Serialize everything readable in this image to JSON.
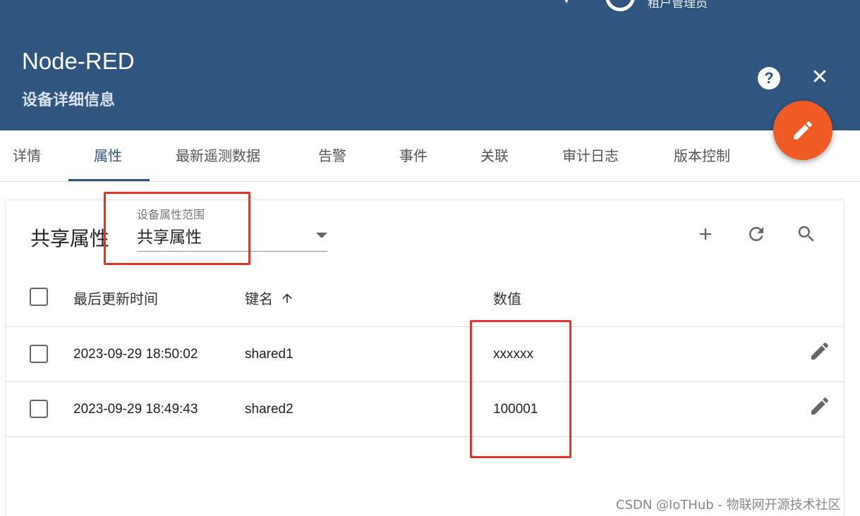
{
  "header": {
    "user_role": "租户管理员",
    "title": "Node-RED",
    "subtitle": "设备详细信息"
  },
  "tabs": [
    {
      "label": "详情"
    },
    {
      "label": "属性"
    },
    {
      "label": "最新遥测数据"
    },
    {
      "label": "告警"
    },
    {
      "label": "事件"
    },
    {
      "label": "关联"
    },
    {
      "label": "审计日志"
    },
    {
      "label": "版本控制"
    }
  ],
  "active_tab": "属性",
  "card": {
    "title": "共享属性",
    "scope_label": "设备属性范围",
    "scope_value": "共享属性"
  },
  "table": {
    "columns": [
      "最后更新时间",
      "键名",
      "数值"
    ],
    "sort_column": "键名",
    "sort_direction": "ascending",
    "rows": [
      {
        "updated": "2023-09-29 18:50:02",
        "key": "shared1",
        "value": "xxxxxx"
      },
      {
        "updated": "2023-09-29 18:49:43",
        "key": "shared2",
        "value": "100001"
      }
    ]
  },
  "icons": {
    "help": "help-icon",
    "close": "close-icon",
    "fab": "edit-icon",
    "add": "add-icon",
    "refresh": "refresh-icon",
    "search": "search-icon",
    "sort": "arrow-up-icon"
  },
  "colors": {
    "header": "#305680",
    "fab": "#f05a24",
    "highlight": "#e8322a"
  },
  "watermark": "CSDN @IoTHub - 物联网开源技术社区"
}
